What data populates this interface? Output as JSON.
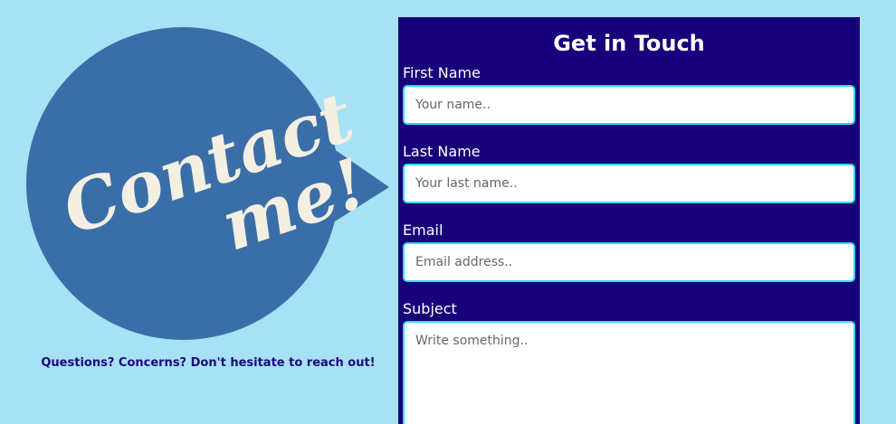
{
  "logo": {
    "text_line1": "Contact",
    "text_line2": "me!",
    "bubble_color": "#3a6ea8",
    "text_color": "#f3efe2"
  },
  "tagline": "Questions? Concerns? Don't hesitate to reach out!",
  "form": {
    "title": "Get in Touch",
    "first_name": {
      "label": "First Name",
      "placeholder": "Your name.."
    },
    "last_name": {
      "label": "Last Name",
      "placeholder": "Your last name.."
    },
    "email": {
      "label": "Email",
      "placeholder": "Email address.."
    },
    "subject": {
      "label": "Subject",
      "placeholder": "Write something.."
    }
  },
  "colors": {
    "background": "#a6e1f5",
    "panel": "#18007a",
    "input_border": "#37d7f0",
    "tagline": "#1a0a7a"
  }
}
